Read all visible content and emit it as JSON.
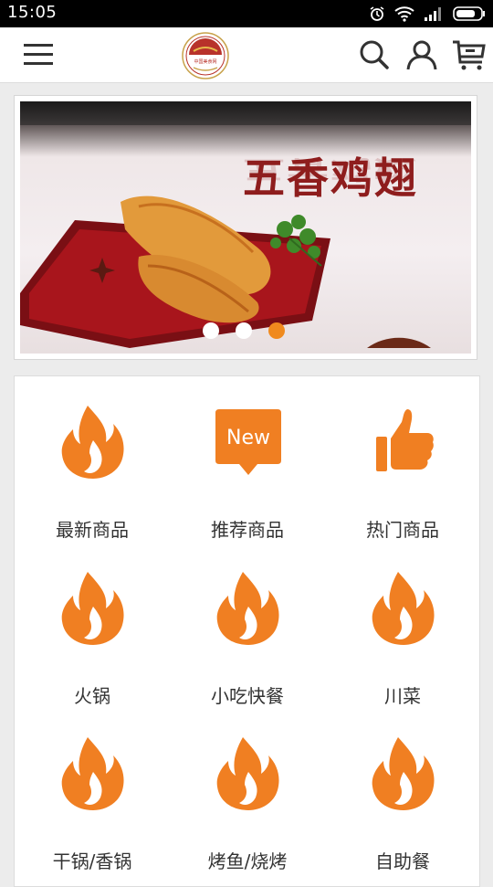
{
  "status_bar": {
    "time": "15:05"
  },
  "header": {
    "logo_text": "中国美食网"
  },
  "banner": {
    "title": "五香鸡翅",
    "dots_count": 3,
    "active_dot": 3
  },
  "categories": [
    {
      "label": "最新商品",
      "icon": "flame-icon"
    },
    {
      "label": "推荐商品",
      "icon": "new-badge-icon",
      "badge_text": "New"
    },
    {
      "label": "热门商品",
      "icon": "thumbs-up-icon"
    },
    {
      "label": "火锅",
      "icon": "flame-icon"
    },
    {
      "label": "小吃快餐",
      "icon": "flame-icon"
    },
    {
      "label": "川菜",
      "icon": "flame-icon"
    },
    {
      "label": "干锅/香锅",
      "icon": "flame-icon"
    },
    {
      "label": "烤鱼/烧烤",
      "icon": "flame-icon"
    },
    {
      "label": "自助餐",
      "icon": "flame-icon"
    }
  ],
  "colors": {
    "accent": "#f08a1e",
    "text": "#333333",
    "background": "#ececec"
  }
}
